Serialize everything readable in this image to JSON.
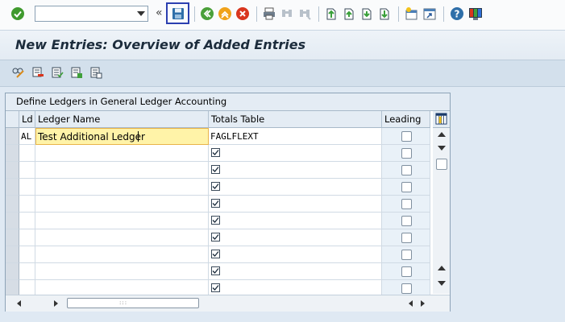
{
  "toolbar": {
    "command_field": {
      "value": "",
      "placeholder": ""
    },
    "icons": [
      "enter-icon",
      "save-icon",
      "back-icon",
      "exit-icon",
      "cancel-icon",
      "print-icon",
      "find-icon",
      "find-next-icon",
      "first-page-icon",
      "previous-page-icon",
      "next-page-icon",
      "last-page-icon",
      "create-session-icon",
      "shortcut-icon",
      "help-icon",
      "customize-layout-icon"
    ],
    "expand_glyph": "«"
  },
  "title": "New Entries: Overview of Added Entries",
  "app_toolbar": {
    "icons": [
      "change-display-icon",
      "delete-icon",
      "select-all-icon",
      "select-block-icon",
      "deselect-all-icon"
    ]
  },
  "table": {
    "caption": "Define Ledgers in General Ledger Accounting",
    "columns": [
      "Ld",
      "Ledger Name",
      "Totals Table",
      "Leading"
    ],
    "rows": [
      {
        "ld": "AL",
        "ledger_name": "Test Additional Ledger",
        "totals_table": "FAGLFLEXT",
        "checked_totals": false,
        "leading": false
      },
      {
        "ld": "",
        "ledger_name": "",
        "totals_table": "",
        "checked_totals": true,
        "leading": false
      },
      {
        "ld": "",
        "ledger_name": "",
        "totals_table": "",
        "checked_totals": true,
        "leading": false
      },
      {
        "ld": "",
        "ledger_name": "",
        "totals_table": "",
        "checked_totals": true,
        "leading": false
      },
      {
        "ld": "",
        "ledger_name": "",
        "totals_table": "",
        "checked_totals": true,
        "leading": false
      },
      {
        "ld": "",
        "ledger_name": "",
        "totals_table": "",
        "checked_totals": true,
        "leading": false
      },
      {
        "ld": "",
        "ledger_name": "",
        "totals_table": "",
        "checked_totals": true,
        "leading": false
      },
      {
        "ld": "",
        "ledger_name": "",
        "totals_table": "",
        "checked_totals": true,
        "leading": false
      },
      {
        "ld": "",
        "ledger_name": "",
        "totals_table": "",
        "checked_totals": true,
        "leading": false
      },
      {
        "ld": "",
        "ledger_name": "",
        "totals_table": "",
        "checked_totals": true,
        "leading": false
      }
    ],
    "horizontal_scroll_grip": ":::"
  },
  "colors": {
    "accent_highlight": "#2b3fb0",
    "focused_cell": "#fff3a8",
    "background": "#dfe9f3"
  }
}
